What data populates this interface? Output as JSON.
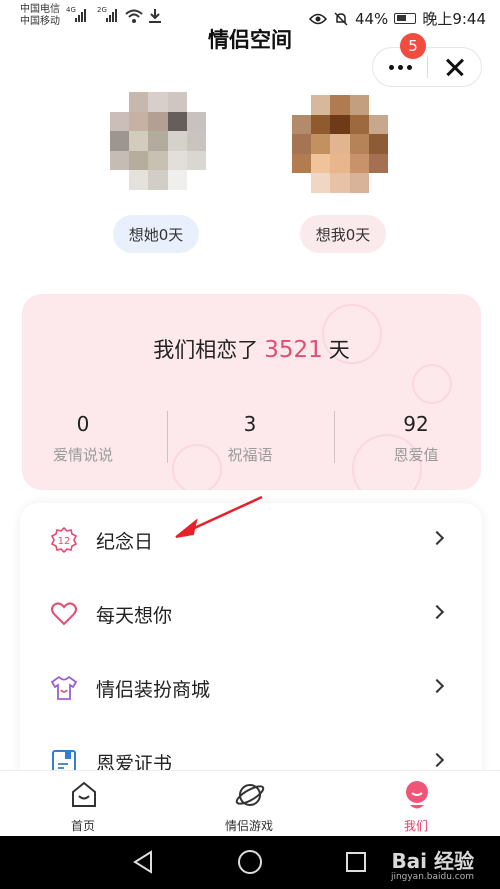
{
  "status_bar": {
    "carrier_1": "中国电信",
    "carrier_2": "中国移动",
    "net_1": "4G",
    "net_2": "2G",
    "battery": "44%",
    "time": "晚上9:44"
  },
  "header": {
    "title": "情侣空间",
    "notification_count": "5"
  },
  "profiles": {
    "her_pill": "想她0天",
    "me_pill": "想我0天"
  },
  "love": {
    "prefix": "我们相恋了",
    "days": "3521",
    "suffix": "天",
    "stats": [
      {
        "value": "0",
        "label": "爱情说说"
      },
      {
        "value": "3",
        "label": "祝福语"
      },
      {
        "value": "92",
        "label": "恩爱值"
      }
    ]
  },
  "menu": {
    "items": [
      {
        "label": "纪念日",
        "icon": "anniversary-12-icon"
      },
      {
        "label": "每天想你",
        "icon": "heart-icon"
      },
      {
        "label": "情侣装扮商城",
        "icon": "tshirt-icon"
      },
      {
        "label": "恩爱证书",
        "icon": "certificate-icon"
      }
    ],
    "anniversary_icon_text": "12"
  },
  "tabs": [
    {
      "label": "首页",
      "icon": "home-icon"
    },
    {
      "label": "情侣游戏",
      "icon": "planet-icon"
    },
    {
      "label": "我们",
      "icon": "couple-icon"
    }
  ],
  "watermark": {
    "brand": "Bai 经验",
    "url": "jingyan.baidu.com"
  },
  "colors": {
    "accent": "#e34d72",
    "badge": "#f14c3f",
    "card_pink": "#fde9ec",
    "arrow": "#e8202a"
  }
}
